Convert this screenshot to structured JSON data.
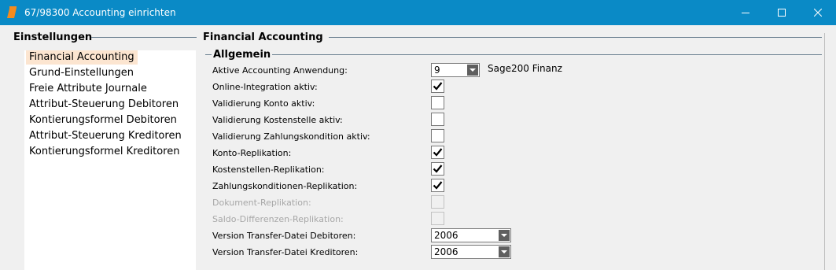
{
  "window": {
    "title": "67/98300 Accounting einrichten",
    "icon": "app-logo-icon",
    "controls": [
      "minimize-icon",
      "maximize-icon",
      "close-icon"
    ]
  },
  "sidebar": {
    "header": "Einstellungen",
    "items": [
      {
        "label": "Financial Accounting",
        "selected": true
      },
      {
        "label": "Grund-Einstellungen"
      },
      {
        "label": "Freie Attribute Journale"
      },
      {
        "label": "Attribut-Steuerung Debitoren"
      },
      {
        "label": "Kontierungsformel Debitoren"
      },
      {
        "label": "Attribut-Steuerung Kreditoren"
      },
      {
        "label": "Kontierungsformel Kreditoren"
      }
    ]
  },
  "main": {
    "header": "Financial Accounting",
    "group": "Allgemein",
    "fields": {
      "accounting_app": {
        "label": "Aktive Accounting Anwendung:",
        "value": "9",
        "info": "Sage200 Finanz"
      },
      "online_integration": {
        "label": "Online-Integration aktiv:",
        "checked": true
      },
      "validierung_konto": {
        "label": "Validierung Konto aktiv:",
        "checked": false
      },
      "validierung_kostenstelle": {
        "label": "Validierung Kostenstelle aktiv:",
        "checked": false
      },
      "validierung_zahlungskondition": {
        "label": "Validierung Zahlungskondition aktiv:",
        "checked": false
      },
      "konto_replikation": {
        "label": "Konto-Replikation:",
        "checked": true
      },
      "kostenstellen_replikation": {
        "label": "Kostenstellen-Replikation:",
        "checked": true
      },
      "zahlungskonditionen_replikation": {
        "label": "Zahlungskonditionen-Replikation:",
        "checked": true
      },
      "dokument_replikation": {
        "label": "Dokument-Replikation:",
        "checked": false,
        "disabled": true
      },
      "saldo_replikation": {
        "label": "Saldo-Differenzen-Replikation:",
        "checked": false,
        "disabled": true
      },
      "version_debitoren": {
        "label": "Version Transfer-Datei Debitoren:",
        "value": "2006"
      },
      "version_kreditoren": {
        "label": "Version Transfer-Datei Kreditoren:",
        "value": "2006"
      }
    }
  },
  "colors": {
    "titlebar": "#0a8ac6",
    "selection": "#fce5d0",
    "panel": "#f0f0f0"
  }
}
